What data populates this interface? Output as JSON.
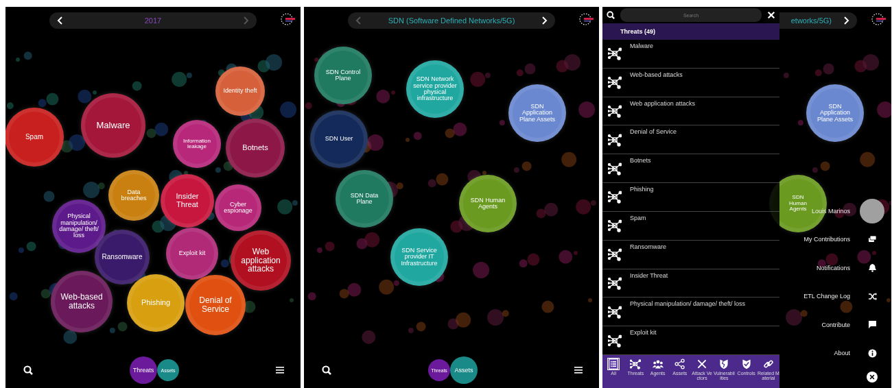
{
  "screens": [
    {
      "header": {
        "prev_disabled": false,
        "title": "2017",
        "next_disabled": true
      },
      "bubbles": [
        {
          "label": "Spam",
          "color": "#c8201e"
        },
        {
          "label": "Malware",
          "color": "#a5173a"
        },
        {
          "label": "Identity theft",
          "color": "#d6603a"
        },
        {
          "label": "Information leakage",
          "color": "#b8287a"
        },
        {
          "label": "Botnets",
          "color": "#8d1848"
        },
        {
          "label": "Data breaches",
          "color": "#c98010"
        },
        {
          "label": "Insider Threat",
          "color": "#c8173e"
        },
        {
          "label": "Cyber espionage",
          "color": "#b82878"
        },
        {
          "label": "Physical manipulation/ damage/ theft/ loss",
          "color": "#5d1a8a"
        },
        {
          "label": "Ransomware",
          "color": "#3a1a6a"
        },
        {
          "label": "Exploit kit",
          "color": "#b02a78"
        },
        {
          "label": "Web application attacks",
          "color": "#b01020"
        },
        {
          "label": "Web-based attacks",
          "color": "#6a1a5a"
        },
        {
          "label": "Phishing",
          "color": "#d8a010"
        },
        {
          "label": "Denial of Service",
          "color": "#e05010"
        }
      ],
      "toggle": [
        {
          "label": "Threats",
          "selected": true
        },
        {
          "label": "Assets",
          "selected": false
        }
      ]
    },
    {
      "header": {
        "prev_disabled": true,
        "title": "SDN (Software Defined Networks/5G)",
        "next_disabled": false
      },
      "bubbles": [
        {
          "label": "SDN Control Plane",
          "color": "#1f7a60"
        },
        {
          "label": "SDN Network service provider physical infrastructure",
          "color": "#20a8a0"
        },
        {
          "label": "SDN Application Plane Assets",
          "color": "#6a88d0"
        },
        {
          "label": "SDN User",
          "color": "#142a5a"
        },
        {
          "label": "SDN Data Plane",
          "color": "#1f7a60"
        },
        {
          "label": "SDN Human Agents",
          "color": "#6a9a20"
        },
        {
          "label": "SDN Service provider IT Infrastructure",
          "color": "#20a8a0"
        }
      ],
      "toggle": [
        {
          "label": "Threats",
          "selected": false
        },
        {
          "label": "Assets",
          "selected": true
        }
      ]
    }
  ],
  "menu_screen": {
    "header": {
      "title": "etworks/5G)",
      "next_disabled": false
    },
    "bubbles": [
      {
        "label": "SDN Application Plane Assets",
        "color": "#6a88d0"
      },
      {
        "label": "SDN Human Agents",
        "color": "#6a9a20"
      }
    ],
    "search": {
      "placeholder": "Search"
    },
    "list": {
      "header": "Threats (49)",
      "items": [
        "Malware",
        "Web-based attacks",
        "Web application attacks",
        "Denial of Service",
        "Botnets",
        "Phishing",
        "Spam",
        "Ransomware",
        "Insider Threat",
        "Physical manipulation/ damage/ theft/ loss",
        "Exploit kit"
      ]
    },
    "categories": [
      {
        "label": "All",
        "selected": true
      },
      {
        "label": "Threats",
        "selected": false
      },
      {
        "label": "Agents",
        "selected": false
      },
      {
        "label": "Assets",
        "selected": false
      },
      {
        "label": "Attack Vectors",
        "selected": false
      },
      {
        "label": "Vulnerabilities",
        "selected": false
      },
      {
        "label": "Controls",
        "selected": false
      },
      {
        "label": "Related Material",
        "selected": false
      }
    ],
    "menu": {
      "user": "Louis Marinos",
      "items": [
        "My Contributions",
        "Notifications",
        "ETL Change Log",
        "Contribute",
        "About"
      ]
    }
  }
}
